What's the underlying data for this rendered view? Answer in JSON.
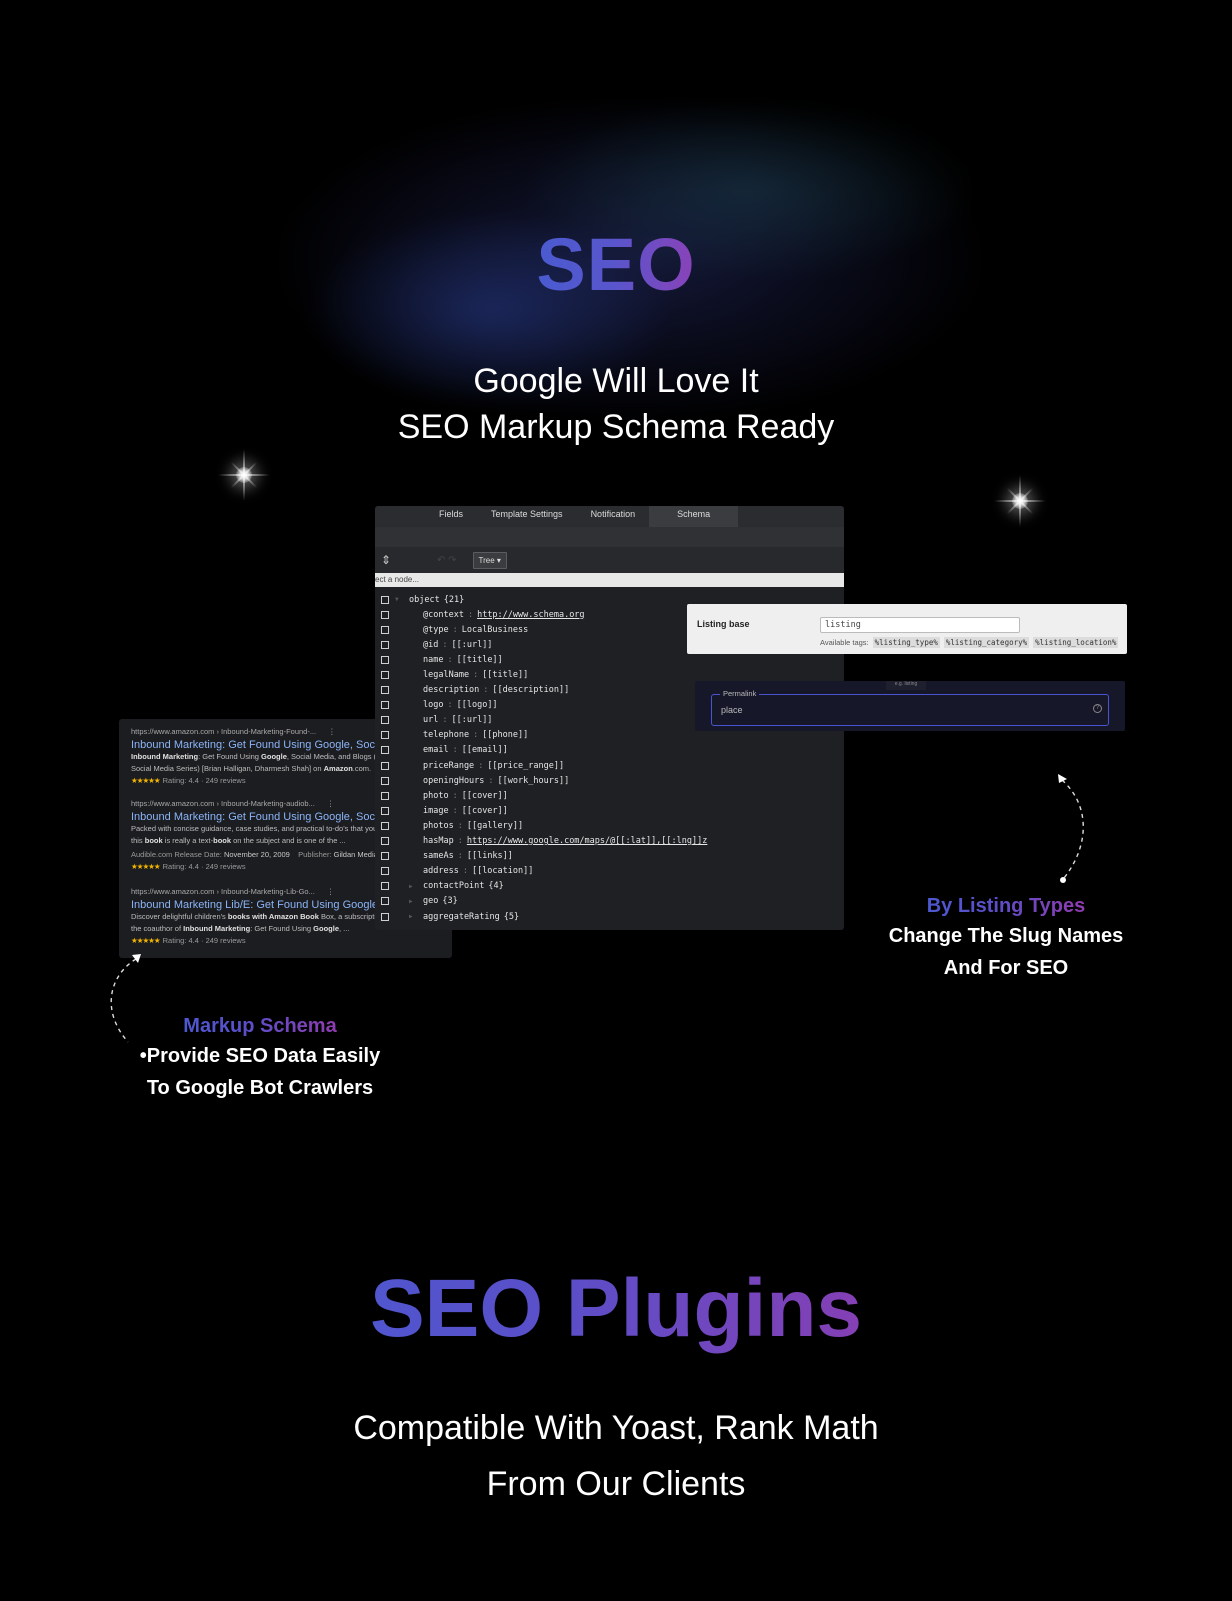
{
  "hero": {
    "title": "SEO",
    "subtitle_line1": "Google Will Love It",
    "subtitle_line2": "SEO Markup Schema Ready"
  },
  "schema_panel": {
    "tabs": [
      {
        "label": "Fields",
        "active": false
      },
      {
        "label": "Template Settings",
        "active": false
      },
      {
        "label": "Notification",
        "active": false
      },
      {
        "label": "Schema",
        "active": true
      }
    ],
    "toolbar": {
      "mode_button": "Tree ▾"
    },
    "search_placeholder": "ect a node...",
    "root": {
      "key": "object",
      "count": "{21}"
    },
    "rows": [
      {
        "key": "@context",
        "value": "http://www.schema.org",
        "link": true
      },
      {
        "key": "@type",
        "value": "LocalBusiness"
      },
      {
        "key": "@id ",
        "value": "[[:url]]"
      },
      {
        "key": "name",
        "value": "[[title]]"
      },
      {
        "key": "legalName",
        "value": "[[title]]"
      },
      {
        "key": "description",
        "value": "[[description]]"
      },
      {
        "key": "logo",
        "value": "[[logo]]"
      },
      {
        "key": "url ",
        "value": "[[:url]]"
      },
      {
        "key": "telephone",
        "value": "[[phone]]"
      },
      {
        "key": "email",
        "value": "[[email]]"
      },
      {
        "key": "priceRange",
        "value": "[[price_range]]"
      },
      {
        "key": "openingHours",
        "value": "[[work_hours]]"
      },
      {
        "key": "photo",
        "value": "[[cover]]"
      },
      {
        "key": "image",
        "value": "[[cover]]"
      },
      {
        "key": "photos",
        "value": "[[gallery]]"
      },
      {
        "key": "hasMap",
        "value": "https://www.google.com/maps/@[[:lat]],[[:lng]]z",
        "link": true
      },
      {
        "key": "sameAs",
        "value": "[[links]]"
      },
      {
        "key": "address",
        "value": "[[location]]"
      }
    ],
    "objects": [
      {
        "key": "contactPoint",
        "count": "{4}"
      },
      {
        "key": "geo ",
        "count": "{3}"
      },
      {
        "key": "aggregateRating",
        "count": "{5}"
      }
    ]
  },
  "listing_base": {
    "label": "Listing base",
    "value": "listing",
    "tags_label": "Available tags:",
    "tags": [
      "%listing_type%",
      "%listing_category%",
      "%listing_location%"
    ]
  },
  "permalink": {
    "legend": "Permalink",
    "value": "place",
    "tooltip": "e.g. listing"
  },
  "serp": {
    "results": [
      {
        "url": "https://www.amazon.com › Inbound-Marketing-Found-...",
        "title": "Inbound Marketing: Get Found Using Google, Social",
        "desc1_html": "<b>Inbound Marketing</b>: Get Found Using <b>Google</b>, Social Media, and Blogs (",
        "desc2_html": "Social Media Series) [Brian Halligan, Dharmesh Shah] on <b>Amazon</b>.com.",
        "meta_html": "",
        "rating": "Rating: 4.4 · 249 reviews"
      },
      {
        "url": "https://www.amazon.com › Inbound-Marketing-audiob...",
        "title": "Inbound Marketing: Get Found Using Google, Social",
        "desc1_html": "Packed with concise guidance, case studies, and practical to-do's that you",
        "desc2_html": "this <b>book</b> is really a text-<b>book</b> on the subject and is one of the ...",
        "meta_html": "Audible.com Release Date: <b>November 20, 2009</b> &nbsp;&nbsp; Publisher: <b>Gildan Media</b>",
        "rating": "Rating: 4.4 · 249 reviews"
      },
      {
        "url": "https://www.amazon.com › Inbound-Marketing-Lib-Go...",
        "title": "Inbound Marketing Lib/E: Get Found Using Google, S",
        "desc1_html": "Discover delightful children's <b>books with Amazon Book</b> Box, a subscription",
        "desc2_html": "the coauthor of <b>Inbound Marketing</b>: Get Found Using <b>Google</b>, ...",
        "meta_html": "",
        "rating": "Rating: 4.4 · 249 reviews"
      }
    ],
    "stars": "★★★★★"
  },
  "captions": {
    "markup": {
      "heading_part1": "Markup ",
      "heading_part2": "Schema",
      "line1": "•Provide SEO Data Easily",
      "line2": "To Google Bot Crawlers"
    },
    "listing": {
      "heading_part1": "By Listing ",
      "heading_part2": "Types",
      "line1": "Change The Slug Names",
      "line2": "And For SEO"
    }
  },
  "plugins": {
    "title_part1": "SEO ",
    "title_part2": "Plugins",
    "line1": "Compatible With Yoast, Rank Math",
    "line2": "From Our Clients"
  },
  "colors": {
    "gradient_blue": "#3d63d8",
    "gradient_purple": "#8e3cb0",
    "gradient_pink": "#c2288a",
    "serp_link": "#8ab4f8",
    "star_gold": "#f0b400",
    "permalink_border": "#4a53d0"
  }
}
